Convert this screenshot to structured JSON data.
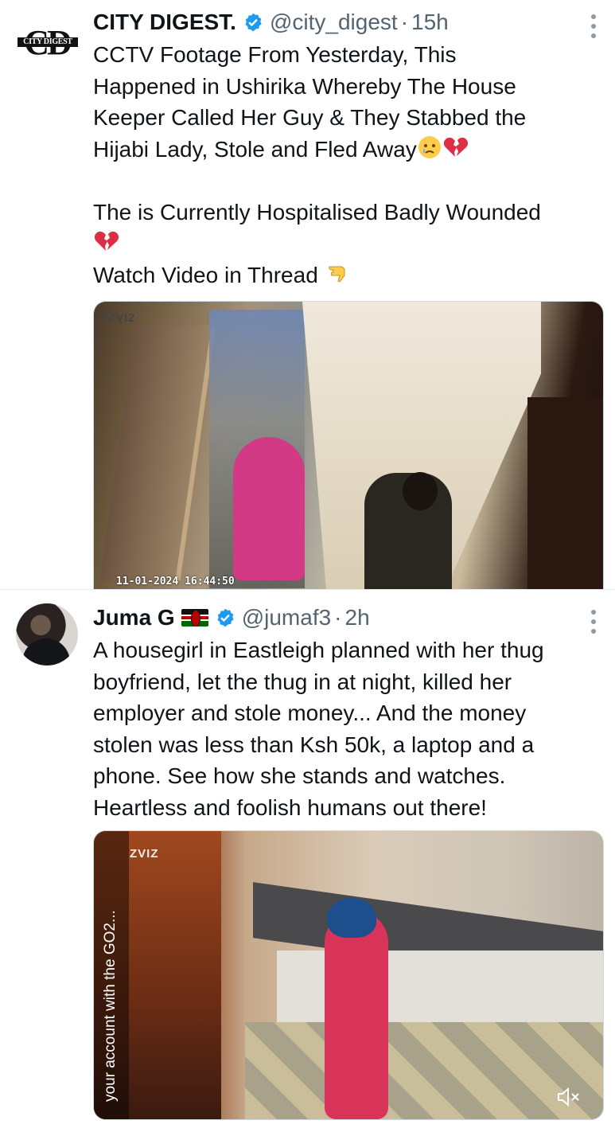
{
  "tweets": [
    {
      "avatar_text": "CD",
      "avatar_subtext": "CITY DIGEST",
      "name": "CITY DIGEST.",
      "handle": "@city_digest",
      "separator": "·",
      "time": "15h",
      "text_lines": [
        "CCTV Footage From Yesterday, This",
        "Happened in Ushirika Whereby The House",
        "Keeper Called Her Guy & They Stabbed the",
        "Hijabi Lady, Stole and Fled Away"
      ],
      "text_lines_2": [
        "The is Currently Hospitalised Badly Wounded"
      ],
      "text_line_3": "Watch Video in Thread",
      "emojis": [
        "crying-face-emoji",
        "broken-heart-emoji",
        "pointing-down-emoji"
      ],
      "media": {
        "camera_brand": "EZVIZ",
        "timestamp": "11-01-2024 16:44:50"
      }
    },
    {
      "name": "Juma G",
      "flag": "kenya-flag",
      "handle": "@jumaf3",
      "separator": "·",
      "time": "2h",
      "text_lines": [
        "A housegirl in Eastleigh planned with her thug",
        "boyfriend, let the thug in at night, killed her",
        "employer and stole money... And the money",
        "stolen was less than Ksh 50k, a laptop and a",
        "phone. See how she stands and watches.",
        "Heartless and foolish humans out there!"
      ],
      "media": {
        "camera_brand": "ZVIZ",
        "promo_text": "your account with the GO2..."
      }
    }
  ],
  "colors": {
    "verified_blue": "#1d9bf0",
    "text": "#0f1419",
    "secondary": "#536471",
    "divider": "#e6e9ec"
  }
}
